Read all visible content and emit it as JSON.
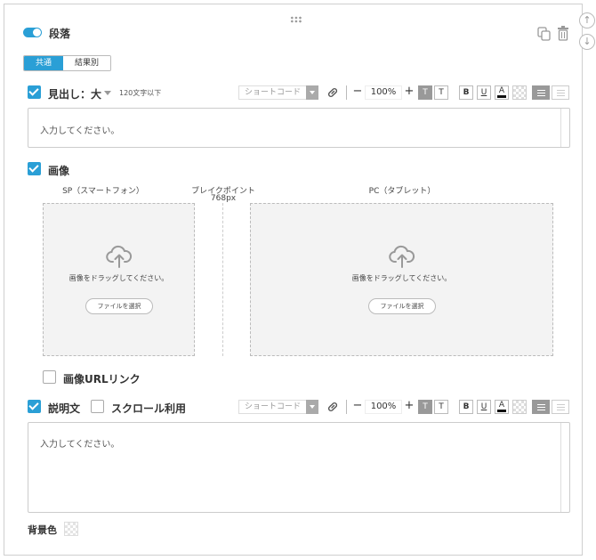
{
  "block": {
    "title": "段落",
    "enabled": true
  },
  "tabs": [
    {
      "label": "共通",
      "active": true
    },
    {
      "label": "結果別",
      "active": false
    }
  ],
  "heading": {
    "label": "見出し：大",
    "hint": "120文字以下",
    "placeholder": "入力してください。",
    "checked": true
  },
  "toolbar": {
    "shortcode_label": "ショートコード",
    "zoom": "100%",
    "minus": "−",
    "plus": "+",
    "t_label": "T",
    "bold_label": "B",
    "underline_label": "U",
    "color_label": "A"
  },
  "image": {
    "label": "画像",
    "checked": true,
    "sp_label": "SP（スマートフォン）",
    "breakpoint_label": "ブレイクポイント",
    "breakpoint_value": "768px",
    "pc_label": "PC（タブレット）",
    "drop_text": "画像をドラッグしてください。",
    "file_button": "ファイルを選択",
    "url_link_label": "画像URLリンク",
    "url_link_checked": false
  },
  "description": {
    "label": "説明文",
    "checked": true,
    "scroll_label": "スクロール利用",
    "scroll_checked": false,
    "placeholder": "入力してください。"
  },
  "background": {
    "label": "背景色"
  },
  "colors": {
    "accent": "#2a9fd6"
  },
  "icons": [
    "drag-handle-icon",
    "arrow-up-icon",
    "arrow-down-icon",
    "copy-icon",
    "trash-icon",
    "chevron-down-icon",
    "link-icon",
    "cloud-upload-icon",
    "checker-icon",
    "align-left-icon",
    "align-right-icon"
  ]
}
